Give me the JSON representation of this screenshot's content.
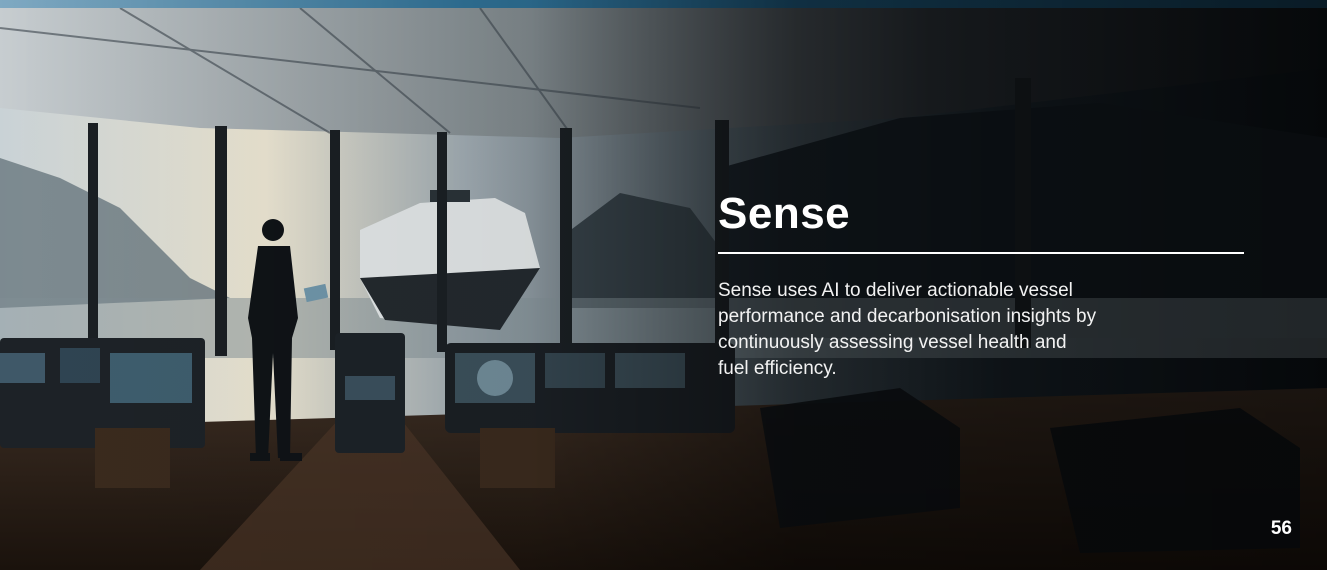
{
  "slide": {
    "title": "Sense",
    "body": "Sense uses AI to deliver actionable vessel performance and decarbonisation insights by continuously assessing vessel health and fuel efficiency.",
    "page_number": "56"
  },
  "colors": {
    "text": "#ffffff",
    "accent_band": "#1d5678",
    "background_dark": "#0b1116"
  },
  "image": {
    "subject": "ship-bridge-photo"
  }
}
